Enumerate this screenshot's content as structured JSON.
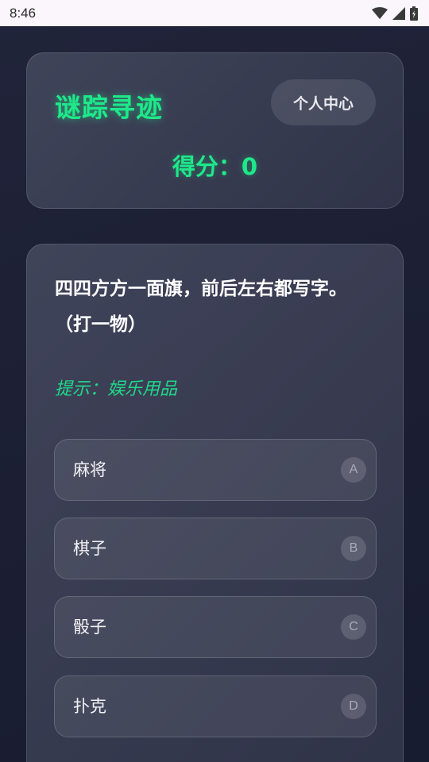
{
  "status_bar": {
    "time": "8:46"
  },
  "header": {
    "title": "谜踪寻迹",
    "profile_button": "个人中心",
    "score_label": "得分：",
    "score_value": "0"
  },
  "question": {
    "text": "四四方方一面旗，前后左右都写字。（打一物）",
    "hint": "提示：娱乐用品",
    "options": [
      {
        "letter": "A",
        "label": "麻将"
      },
      {
        "letter": "B",
        "label": "棋子"
      },
      {
        "letter": "C",
        "label": "骰子"
      },
      {
        "letter": "D",
        "label": "扑克"
      }
    ]
  },
  "colors": {
    "accent": "#1ee98a",
    "background": "#1d2034",
    "card": "#3a3d55"
  }
}
